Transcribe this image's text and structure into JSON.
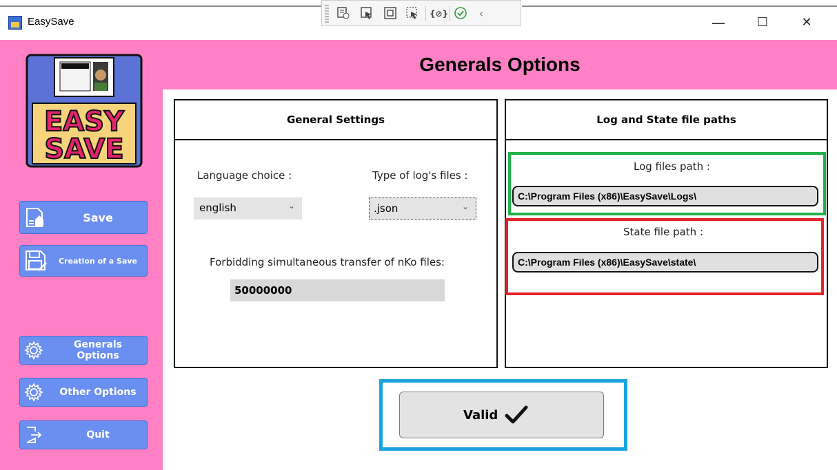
{
  "window": {
    "title": "EasySave",
    "minimize_glyph": "—",
    "maximize_glyph": "☐",
    "close_glyph": "✕"
  },
  "header": {
    "title": "Generals Options"
  },
  "sidebar": {
    "logo_alt": "EASY SAVE",
    "logo_line1": "EASY",
    "logo_line2": "SAVE",
    "items": [
      {
        "label": "Save",
        "icon": "save-page-icon"
      },
      {
        "label": "Creation of a Save",
        "icon": "floppy-edit-icon"
      },
      {
        "label": "Generals Options",
        "icon": "gear-icon"
      },
      {
        "label": "Other Options",
        "icon": "gear-icon"
      },
      {
        "label": "Quit",
        "icon": "exit-icon"
      }
    ]
  },
  "general_settings": {
    "heading": "General Settings",
    "language_label": "Language choice :",
    "language_value": "english",
    "log_type_label": "Type of log's files :",
    "log_type_value": ".json",
    "forbid_label": "Forbidding simultaneous transfer of nKo files:",
    "forbid_value": "50000000"
  },
  "paths": {
    "heading": "Log and State file paths",
    "log_label": "Log files path :",
    "log_value": "C:\\Program Files (x86)\\EasySave\\Logs\\",
    "state_label": "State file path :",
    "state_value": "C:\\Program Files (x86)\\EasySave\\state\\"
  },
  "footer": {
    "valid_label": "Valid"
  },
  "colors": {
    "accent_pink": "#ff80c4",
    "nav_blue": "#6b8ff0",
    "frame_green": "#22b04a",
    "frame_red": "#e3242b",
    "frame_blue": "#1aa3e0"
  }
}
